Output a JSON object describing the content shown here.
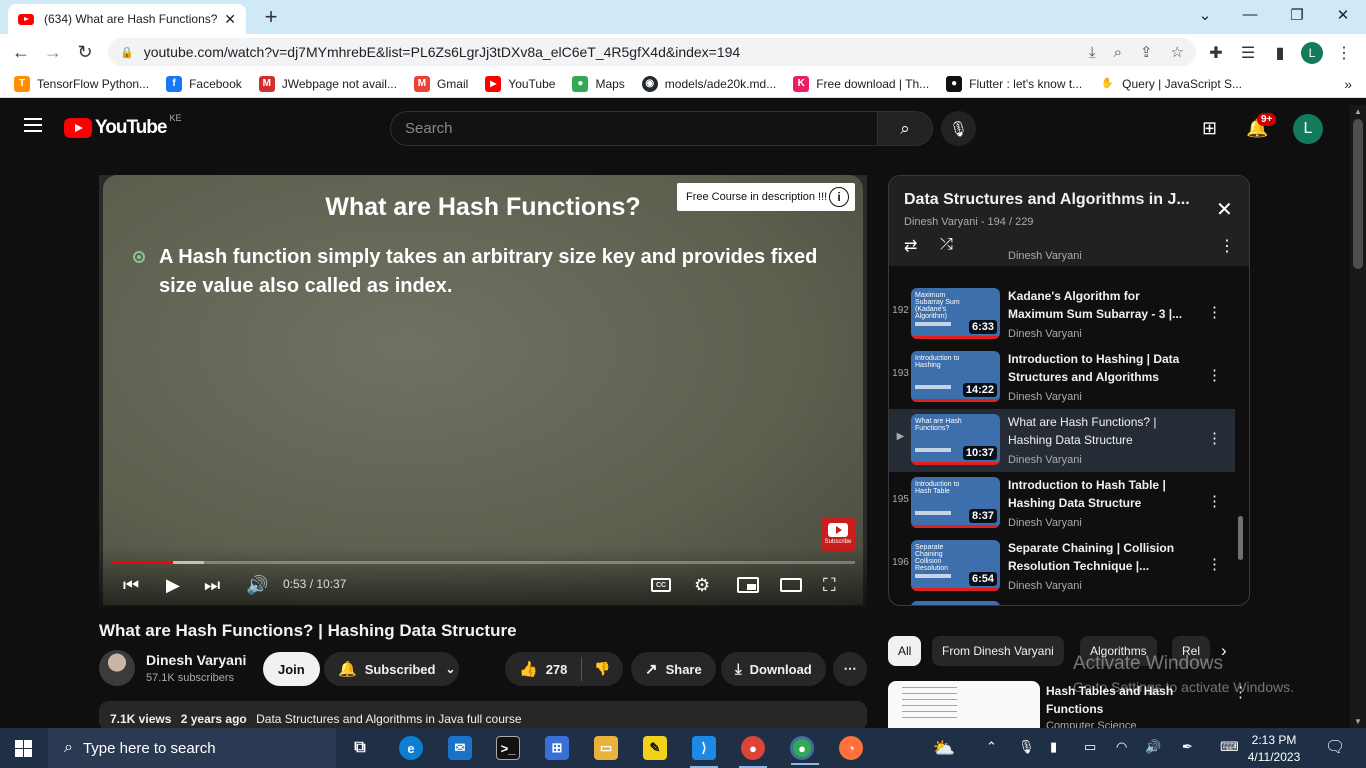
{
  "browser": {
    "tab_title": "(634) What are Hash Functions? |",
    "url": "youtube.com/watch?v=dj7MYmhrebE&list=PL6Zs6LgrJj3tDXv8a_elC6eT_4R5gfX4d&index=194",
    "profile_initial": "L",
    "bookmarks": [
      {
        "label": "TensorFlow Python...",
        "color": "#ff8f00",
        "glyph": "T"
      },
      {
        "label": "Facebook",
        "color": "#1877f2",
        "glyph": "f"
      },
      {
        "label": "JWebpage not avail...",
        "color": "#d32f2f",
        "glyph": "M"
      },
      {
        "label": "Gmail",
        "color": "#ea4335",
        "glyph": "M"
      },
      {
        "label": "YouTube",
        "color": "#ff0000",
        "glyph": "▶"
      },
      {
        "label": "Maps",
        "color": "#34a853",
        "glyph": "●"
      },
      {
        "label": "models/ade20k.md...",
        "color": "#24292f",
        "glyph": "◉"
      },
      {
        "label": "Free download | Th...",
        "color": "#e91e63",
        "glyph": "K"
      },
      {
        "label": "Flutter : let's know t...",
        "color": "#111111",
        "glyph": "●"
      },
      {
        "label": "Query | JavaScript S...",
        "color": "#f4b400",
        "glyph": "✋"
      }
    ]
  },
  "youtube": {
    "region": "KE",
    "logo_text": "YouTube",
    "search_placeholder": "Search",
    "notification_badge": "9+",
    "avatar_initial": "L"
  },
  "player": {
    "slide_title": "What are Hash Functions?",
    "slide_text": "A Hash function simply takes an arbitrary size key and provides fixed size value also called as index.",
    "card_text": "Free Course in description !!!",
    "watermark_label": "Subscribe",
    "time": "0:53 / 10:37",
    "progress_played": 0.083,
    "progress_buffered": 0.125
  },
  "video": {
    "title": "What are Hash Functions? | Hashing Data Structure",
    "channel": "Dinesh Varyani",
    "subscribers": "57.1K subscribers",
    "join_label": "Join",
    "subscribed_label": "Subscribed",
    "likes": "278",
    "share_label": "Share",
    "download_label": "Download",
    "views": "7.1K views",
    "age": "2 years ago",
    "description": "Data Structures and Algorithms in Java full course"
  },
  "playlist": {
    "title": "Data Structures and Algorithms in J...",
    "meta": "Dinesh Varyani - 194 / 229",
    "partial_channel": "Dinesh Varyani",
    "items": [
      {
        "index": "192",
        "thumb": "Maximum Subarray Sum (Kadane's Algorithm)",
        "title": "Kadane's Algorithm for Maximum Sum Subarray - 3 |...",
        "channel": "Dinesh Varyani",
        "duration": "6:33"
      },
      {
        "index": "193",
        "thumb": "Introduction to Hashing",
        "title": "Introduction to Hashing | Data Structures and Algorithms",
        "channel": "Dinesh Varyani",
        "duration": "14:22"
      },
      {
        "index": "▶",
        "thumb": "What are Hash Functions?",
        "title": "What are Hash Functions? | Hashing Data Structure",
        "channel": "Dinesh Varyani",
        "duration": "10:37"
      },
      {
        "index": "195",
        "thumb": "Introduction to Hash Table",
        "title": "Introduction to Hash Table | Hashing Data Structure",
        "channel": "Dinesh Varyani",
        "duration": "8:37"
      },
      {
        "index": "196",
        "thumb": "Separate Chaining Collision Resolution",
        "title": "Separate Chaining | Collision Resolution Technique |...",
        "channel": "Dinesh Varyani",
        "duration": "6:54"
      }
    ]
  },
  "chips": [
    "All",
    "From Dinesh Varyani",
    "Algorithms",
    "Rel"
  ],
  "recommendation": {
    "title": "Hash Tables and Hash Functions",
    "channel": "Computer Science"
  },
  "windows_watermark": {
    "title": "Activate Windows",
    "subtitle": "Go to Settings to activate Windows."
  },
  "taskbar": {
    "search_placeholder": "Type here to search",
    "time": "2:13 PM",
    "date": "4/11/2023"
  }
}
